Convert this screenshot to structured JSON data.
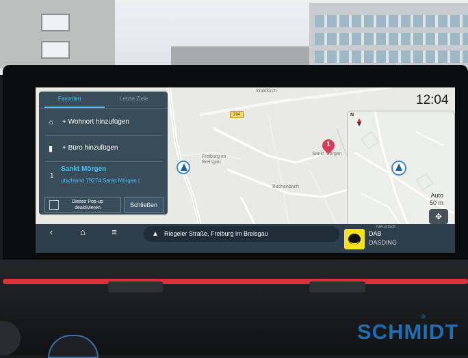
{
  "status": {
    "time": "12:04"
  },
  "popup": {
    "tabs": [
      {
        "label": "Favoriten"
      },
      {
        "label": "Letzte Ziele"
      }
    ],
    "home": {
      "label": "+ Wohnort hinzufügen"
    },
    "office": {
      "label": "+ Büro hinzufügen"
    },
    "favorite": {
      "index": "1",
      "title": "Sankt Mörgen",
      "address": "utschland 79274 Sankt Mörgen |"
    },
    "checkbox": {
      "label": "Dieses Pop-up deaktivieren",
      "checked": false
    },
    "close_label": "Schließen"
  },
  "map": {
    "places": [
      "Waldkirch",
      "Freiburg im Breisgau",
      "Sankt Mörgen",
      "Buchenbach",
      "Neustadt"
    ],
    "road_number": "294",
    "destination_number": "1",
    "minimap": {
      "compass": "N",
      "zoom_mode": "Auto",
      "scale": "50 m"
    }
  },
  "bottombar": {
    "back_icon": "‹",
    "home_icon": "⌂",
    "menu_icon": "≡",
    "route_text": "Riegeler Straße, Freiburg im Breisgau",
    "radio_band": "DAB",
    "radio_station": "DASDING"
  },
  "watermark": {
    "brand": "SCHMIDT"
  },
  "colors": {
    "accent": "#4fc3f7",
    "panel": "#283e4e",
    "pin": "#d93c54",
    "brand": "#1f6db3"
  }
}
